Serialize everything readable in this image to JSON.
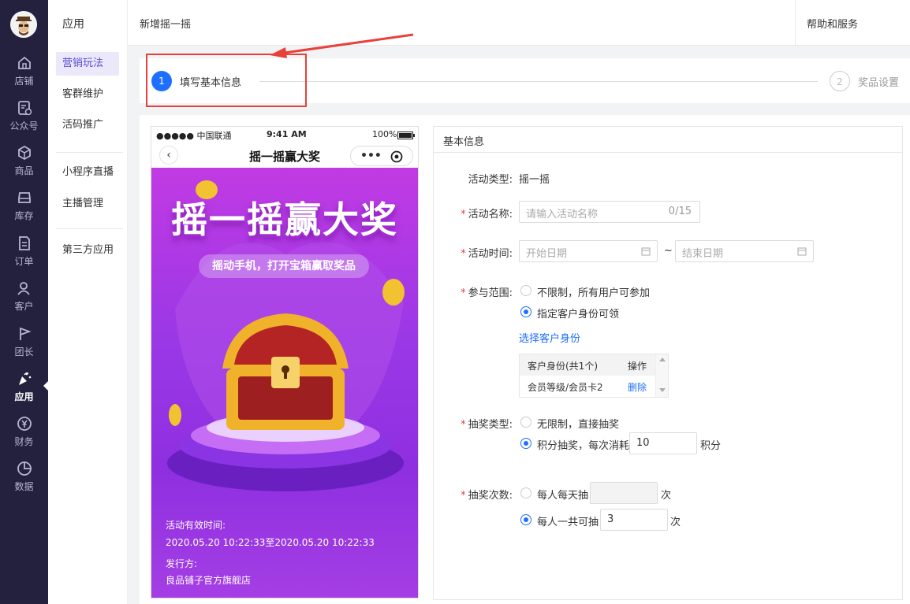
{
  "rail": {
    "items": [
      {
        "label": "店铺",
        "icon": "home-icon"
      },
      {
        "label": "公众号",
        "icon": "official-account-icon"
      },
      {
        "label": "商品",
        "icon": "box-icon"
      },
      {
        "label": "库存",
        "icon": "inventory-icon"
      },
      {
        "label": "订单",
        "icon": "order-icon"
      },
      {
        "label": "客户",
        "icon": "customer-icon"
      },
      {
        "label": "团长",
        "icon": "flag-icon"
      },
      {
        "label": "应用",
        "icon": "party-popper-icon"
      },
      {
        "label": "财务",
        "icon": "yen-icon"
      },
      {
        "label": "数据",
        "icon": "pie-chart-icon"
      }
    ],
    "active": "应用"
  },
  "subnav": {
    "title": "应用",
    "items": [
      "营销玩法",
      "客群维护",
      "活码推广",
      "小程序直播",
      "主播管理",
      "第三方应用"
    ],
    "active": "营销玩法"
  },
  "topbar": {
    "title": "新增摇一摇",
    "help": "帮助和服务"
  },
  "steps": [
    {
      "num": "1",
      "label": "填写基本信息",
      "state": "active"
    },
    {
      "num": "2",
      "label": "奖品设置",
      "state": "todo"
    }
  ],
  "phone": {
    "carrier": "●●●●● 中国联通",
    "time": "9:41 AM",
    "battery": "100%",
    "nav_title": "摇一摇赢大奖",
    "poster_title": "摇一摇赢大奖",
    "poster_subtitle": "摇动手机，打开宝箱赢取奖品",
    "valid_label": "活动有效时间:",
    "valid_range": "2020.05.20 10:22:33至2020.05.20 10:22:33",
    "issuer_label": "发行方:",
    "issuer": "良品铺子官方旗舰店"
  },
  "form": {
    "section_title": "基本信息",
    "type_label": "活动类型:",
    "type_value": "摇一摇",
    "name_label": "活动名称:",
    "name_placeholder": "请输入活动名称",
    "name_count": "0/15",
    "time_label": "活动时间:",
    "start_placeholder": "开始日期",
    "end_placeholder": "结束日期",
    "tilde": "~",
    "scope_label": "参与范围:",
    "scope_opt1": "不限制，所有用户可参加",
    "scope_opt2": "指定客户身份可领",
    "select_identity": "选择客户身份",
    "table_col1": "客户身份(共1个)",
    "table_col2": "操作",
    "table_row_value": "会员等级/会员卡2",
    "table_row_action": "删除",
    "draw_type_label": "抽奖类型:",
    "draw_opt1": "无限制，直接抽奖",
    "draw_opt2": "积分抽奖，每次消耗",
    "points_value": "10",
    "points_unit": "积分",
    "draw_times_label": "抽奖次数:",
    "times_opt1": "每人每天抽",
    "times_opt2": "每人一共可抽",
    "times_total": "3",
    "times_unit": "次"
  },
  "colors": {
    "rail_bg": "#24213f",
    "primary": "#1e6fff",
    "annotation": "#e8403a",
    "subnav_active_bg": "#ebe8fa"
  }
}
